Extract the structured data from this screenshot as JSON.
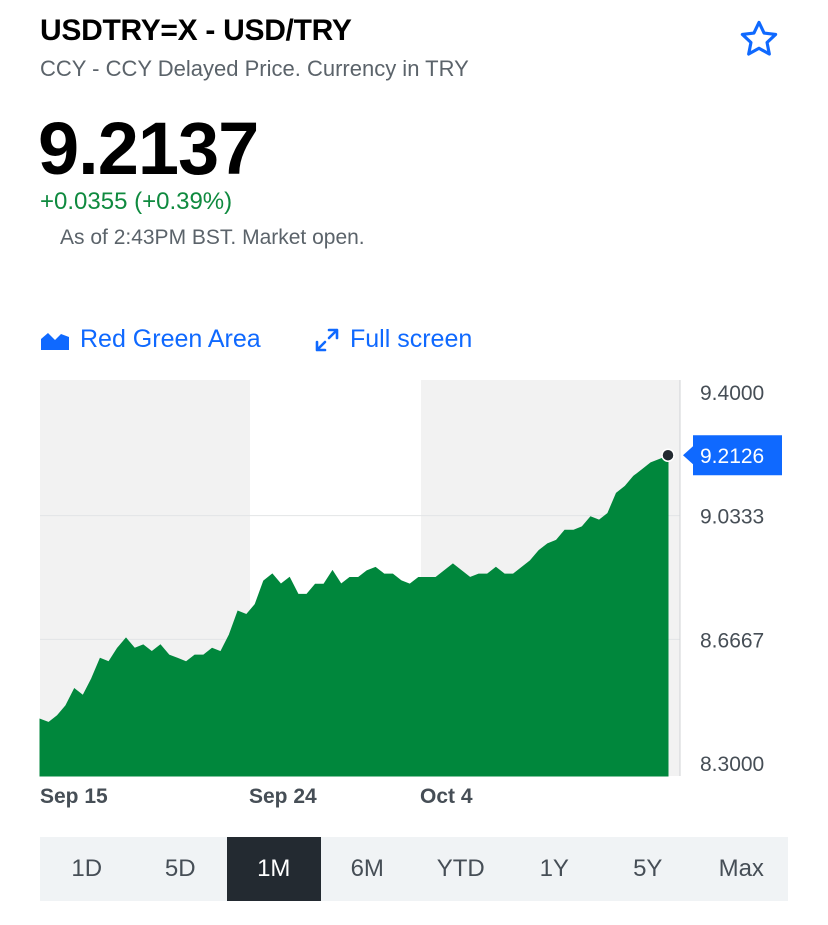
{
  "header": {
    "title": "USDTRY=X - USD/TRY",
    "subtitle": "CCY - CCY Delayed Price. Currency in TRY",
    "star_icon": "star-outline-icon"
  },
  "quote": {
    "price": "9.2137",
    "change": "+0.0355 (+0.39%)",
    "as_of": "As of 2:43PM BST. Market open.",
    "change_color": "#0f8a3f"
  },
  "controls": {
    "chart_type_label": "Red Green Area",
    "chart_type_icon": "area-chart-icon",
    "fullscreen_label": "Full screen",
    "fullscreen_icon": "expand-arrows-icon",
    "accent": "#0f69ff"
  },
  "chart_data": {
    "type": "area",
    "color": "#00873c",
    "ylim": [
      8.3,
      9.4
    ],
    "y_ticks": [
      "9.4000",
      "9.0333",
      "8.6667",
      "8.3000"
    ],
    "x_ticks": [
      "Sep 15",
      "Sep 24",
      "Oct 4"
    ],
    "current_label": "9.2126",
    "current_label_color": "#0f69ff",
    "grid": true,
    "series": [
      {
        "values": [
          8.43,
          8.42,
          8.44,
          8.47,
          8.52,
          8.5,
          8.55,
          8.61,
          8.6,
          8.64,
          8.67,
          8.64,
          8.65,
          8.63,
          8.65,
          8.62,
          8.61,
          8.6,
          8.62,
          8.62,
          8.64,
          8.63,
          8.68,
          8.75,
          8.74,
          8.77,
          8.84,
          8.86,
          8.83,
          8.85,
          8.8,
          8.8,
          8.83,
          8.83,
          8.87,
          8.83,
          8.85,
          8.85,
          8.87,
          8.88,
          8.86,
          8.86,
          8.84,
          8.83,
          8.85,
          8.85,
          8.85,
          8.87,
          8.89,
          8.87,
          8.85,
          8.86,
          8.86,
          8.88,
          8.86,
          8.86,
          8.88,
          8.9,
          8.93,
          8.95,
          8.96,
          8.99,
          8.99,
          9.0,
          9.03,
          9.02,
          9.04,
          9.1,
          9.12,
          9.15,
          9.17,
          9.19,
          9.2,
          9.21
        ]
      }
    ]
  },
  "ranges": {
    "items": [
      "1D",
      "5D",
      "1M",
      "6M",
      "YTD",
      "1Y",
      "5Y",
      "Max"
    ],
    "active": "1M"
  }
}
